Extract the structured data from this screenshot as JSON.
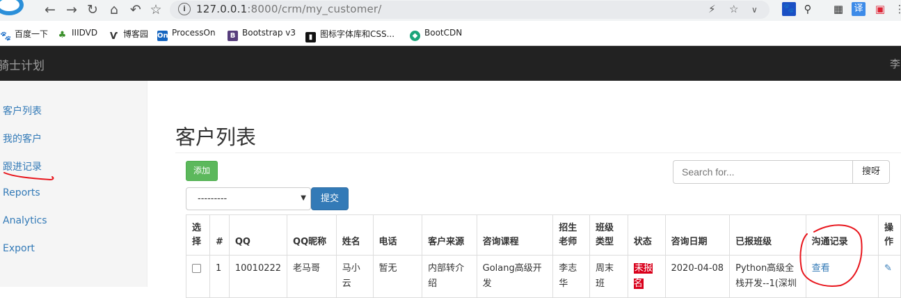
{
  "browser": {
    "url_host": "127.0.0.1",
    "url_path": ":8000/crm/my_customer/",
    "ext_translate": "译",
    "bookmarks": [
      "百度一下",
      "IIIDVD",
      "博客园",
      "ProcessOn",
      "Bootstrap v3",
      "图标字体库和CSS...",
      "BootCDN"
    ]
  },
  "navbar": {
    "brand": "骑士计划",
    "user": "李"
  },
  "sidebar": {
    "items": [
      "客户列表",
      "我的客户",
      "跟进记录",
      "Reports",
      "Analytics",
      "Export"
    ]
  },
  "main": {
    "title": "客户列表",
    "add_label": "添加",
    "search_placeholder": "Search for...",
    "search_button": "搜呀",
    "select_value": "---------",
    "submit_label": "提交"
  },
  "table": {
    "headers": [
      "选择",
      "#",
      "QQ",
      "QQ昵称",
      "姓名",
      "电话",
      "客户来源",
      "咨询课程",
      "招生老师",
      "班级类型",
      "状态",
      "咨询日期",
      "已报班级",
      "沟通记录",
      "操作"
    ],
    "rows": [
      {
        "num": "1",
        "qq": "10010222",
        "nickname": "老马哥",
        "name": "马小云",
        "phone": "暂无",
        "source": "内部转介绍",
        "course": "Golang高级开发",
        "teacher": "李志华",
        "class_type": "周末班",
        "status": "未报名",
        "date": "2020-04-08",
        "enrolled": "Python高级全栈开发--1(深圳",
        "records": "查看"
      }
    ]
  },
  "colors": {
    "status_unenrolled": "#d9001b",
    "add_green": "#5cb85c",
    "primary_blue": "#337ab7",
    "navbar": "#222222",
    "annotation_red": "#e8141b"
  }
}
